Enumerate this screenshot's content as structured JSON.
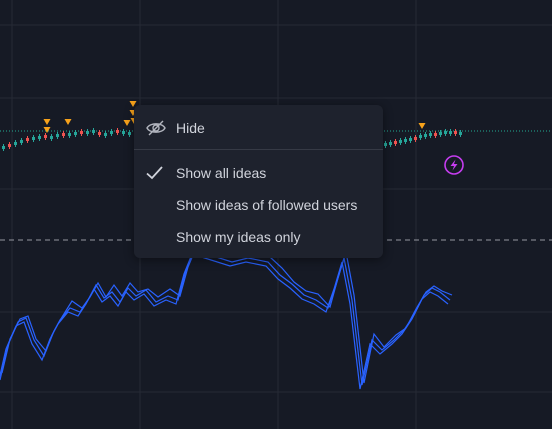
{
  "chart": {
    "background": "#161a25",
    "grid_color": "#262a35",
    "line_color": "#2962ff",
    "candle_up": "#26a69a",
    "candle_down": "#ef5350",
    "marker_color": "#f7a21b",
    "dotted_line_color": "#22ab94",
    "dashed_line_color": "#9598a1",
    "ideas_icon_color": "#c63df0",
    "ideas_icon": "lightning-bolt-icon"
  },
  "menu": {
    "hide_label": "Hide",
    "hide_icon": "eye-off-icon",
    "items": [
      {
        "label": "Show all ideas",
        "checked": true
      },
      {
        "label": "Show ideas of followed users",
        "checked": false
      },
      {
        "label": "Show my ideas only",
        "checked": false
      }
    ],
    "check_icon": "checkmark-icon"
  }
}
